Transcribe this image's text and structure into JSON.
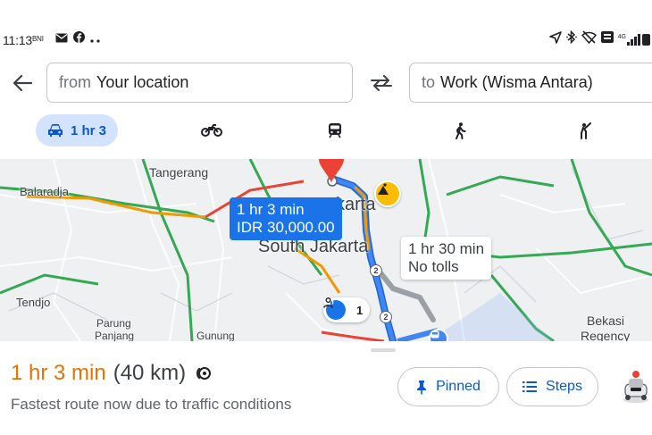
{
  "status_bar": {
    "time": "11:13",
    "carrier": "BNI",
    "network": "4G",
    "left_icons": [
      "bni-icon",
      "mail-icon",
      "facebook-icon",
      "more-dots-icon"
    ],
    "right_icons": [
      "location-arrow-icon",
      "bluetooth-icon",
      "wifi-off-icon",
      "volte-icon",
      "signal-icon"
    ]
  },
  "directions": {
    "from_prefix": "from",
    "from_value": "Your location",
    "to_prefix": "to",
    "to_value": "Work (Wisma Antara)"
  },
  "modes": [
    {
      "name": "drive",
      "label": "1 hr 3",
      "active": true
    },
    {
      "name": "motorcycle",
      "label": ""
    },
    {
      "name": "transit",
      "label": ""
    },
    {
      "name": "walk",
      "label": ""
    },
    {
      "name": "ride-hail",
      "label": ""
    }
  ],
  "map": {
    "labels": {
      "tangerang": "Tangerang",
      "balaradja": "Balaradja",
      "jakarta_partial": "karta",
      "south_jakarta": "South Jakarta",
      "tendjo": "Tendjo",
      "parung": "Parung",
      "panjang": "Panjang",
      "gunung": "Gunung",
      "bekasi": "Bekasi",
      "regency": "Regency"
    },
    "primary_route": {
      "duration": "1 hr 3 min",
      "cost": "IDR 30,000.00"
    },
    "alt_route": {
      "duration": "1 hr 30 min",
      "note": "No tolls"
    },
    "report_count": "1",
    "highway_markers": [
      "2",
      "2"
    ]
  },
  "route_summary": {
    "duration": "1 hr 3 min",
    "distance": "(40 km)",
    "subtitle": "Fastest route now due to traffic conditions",
    "pinned_label": "Pinned",
    "steps_label": "Steps"
  },
  "colors": {
    "accent": "#1a73e8",
    "tab_active_bg": "#d3e3fd",
    "duration": "#e37400",
    "traffic_green": "#34a853",
    "traffic_orange": "#f29900",
    "traffic_red": "#ea4335"
  }
}
